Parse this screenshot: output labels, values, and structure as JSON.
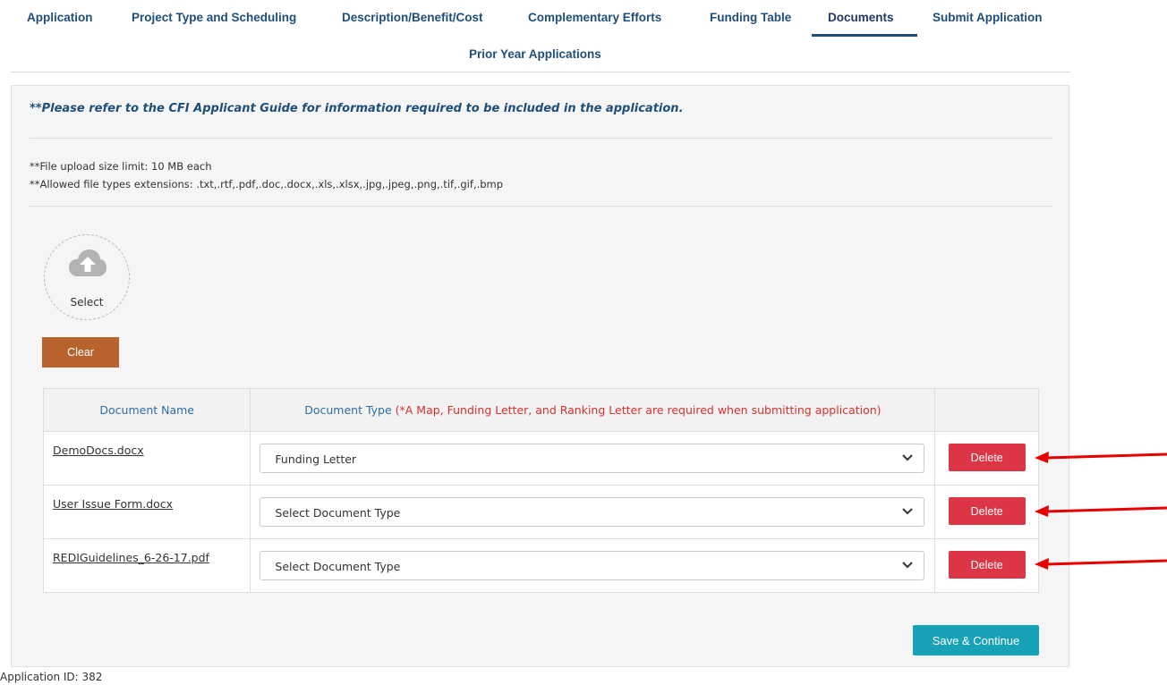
{
  "tabs": [
    {
      "label": "Application"
    },
    {
      "label": "Project Type and Scheduling"
    },
    {
      "label": "Description/Benefit/Cost"
    },
    {
      "label": "Complementary Efforts"
    },
    {
      "label": "Funding Table"
    },
    {
      "label": "Documents",
      "active": true
    },
    {
      "label": "Submit Application"
    },
    {
      "label": "Prior Year Applications"
    }
  ],
  "panel": {
    "note": "**Please refer to the CFI Applicant Guide for information required to be included in the application.",
    "size_limit": "**File upload size limit: 10 MB each",
    "allowed_types": "**Allowed file types extensions: .txt,.rtf,.pdf,.doc,.docx,.xls,.xlsx,.jpg,.jpeg,.png,.tif,.gif,.bmp",
    "upload": {
      "label": "Select",
      "icon": "cloud-upload-icon"
    },
    "clear_label": "Clear",
    "table": {
      "header_name": "Document Name",
      "header_type": "Document Type",
      "header_type_note": "(*A Map, Funding Letter, and Ranking Letter are required when submitting application)",
      "rows": [
        {
          "name": "DemoDocs.docx",
          "type": "Funding Letter",
          "delete_label": "Delete"
        },
        {
          "name": "User Issue Form.docx",
          "type": "Select Document Type",
          "delete_label": "Delete"
        },
        {
          "name": "REDIGuidelines_6-26-17.pdf",
          "type": "Select Document Type",
          "delete_label": "Delete"
        }
      ]
    },
    "save_label": "Save & Continue"
  },
  "footer": {
    "application_id": "Application ID: 382"
  },
  "colors": {
    "tab_text": "#1f4e79",
    "clear_button": "#b8622d",
    "delete_button": "#dc3545",
    "save_button": "#17a2b8",
    "required_note": "#d9302c",
    "annotation_arrow": "#e60000"
  }
}
